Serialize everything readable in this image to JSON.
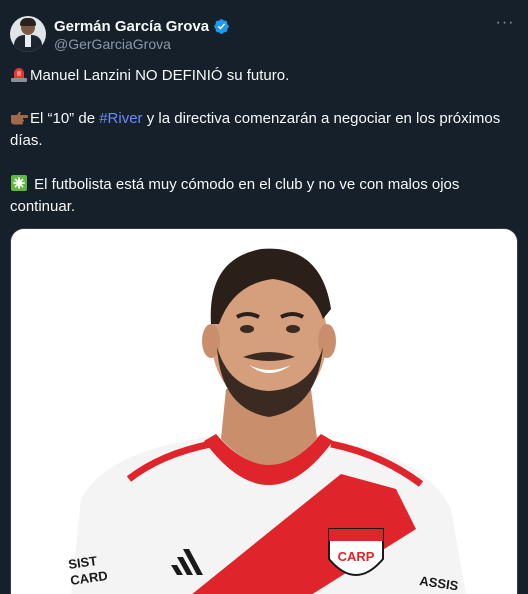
{
  "author": {
    "display_name": "Germán García Grova",
    "handle": "@GerGarciaGrova",
    "verified_icon": "verified-badge-icon",
    "avatar_icon": "avatar"
  },
  "menu": {
    "label": "···",
    "icon": "more-options-icon"
  },
  "tweet": {
    "line1_emoji": "rotating-light-icon",
    "line1_text": "Manuel Lanzini NO DEFINIÓ su futuro.",
    "line2_emoji": "backhand-index-pointing-right-icon",
    "line2_pre": "El “10” de ",
    "line2_hashtag": "#River",
    "line2_post": " y la directiva comenzarán a negociar en los próximos días.",
    "line3_emoji": "eight-spoked-asterisk-icon",
    "line3_text": " El futbolista está muy cómodo en el club y no ve con malos ojos continuar."
  },
  "media": {
    "description_icon": "player-photo",
    "jersey_sponsor_left": "SIST\nCARD",
    "jersey_sponsor_right": "ASSIS",
    "crest_text": "CARP"
  },
  "colors": {
    "background": "#15202b",
    "text": "#f7f9f9",
    "secondary": "#8b98a5",
    "hashtag": "#6b8cf5",
    "verified": "#1d9bf0",
    "river_red": "#e0242b"
  }
}
